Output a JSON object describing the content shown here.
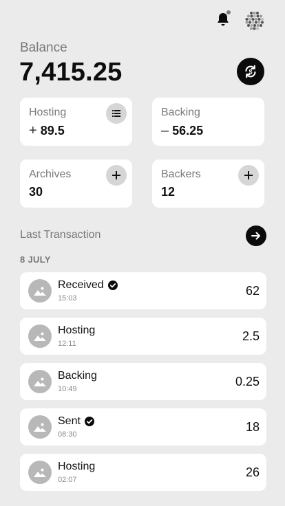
{
  "header": {
    "bell_icon": "bell-icon",
    "avatar_icon": "avatar-pattern-icon"
  },
  "balance": {
    "label": "Balance",
    "value": "7,415.25",
    "sync_icon": "sync-icon"
  },
  "cards": {
    "hosting": {
      "label": "Hosting",
      "sign": "+",
      "value": "89.5",
      "icon": "list-icon"
    },
    "backing": {
      "label": "Backing",
      "sign": "–",
      "value": "56.25"
    },
    "archives": {
      "label": "Archives",
      "value": "30",
      "icon": "plus-icon"
    },
    "backers": {
      "label": "Backers",
      "value": "12",
      "icon": "plus-icon"
    }
  },
  "transactions": {
    "title": "Last Transaction",
    "date": "8 JULY",
    "items": [
      {
        "name": "Received",
        "time": "15:03",
        "amount": "62",
        "verified": true
      },
      {
        "name": "Hosting",
        "time": "12:11",
        "amount": "2.5",
        "verified": false
      },
      {
        "name": "Backing",
        "time": "10:49",
        "amount": "0.25",
        "verified": false
      },
      {
        "name": "Sent",
        "time": "08:30",
        "amount": "18",
        "verified": true
      },
      {
        "name": "Hosting",
        "time": "02:07",
        "amount": "26",
        "verified": false
      }
    ]
  },
  "colors": {
    "background": "#ebebeb",
    "card": "#ffffff",
    "dark": "#0b0b0b",
    "muted": "#777777"
  }
}
